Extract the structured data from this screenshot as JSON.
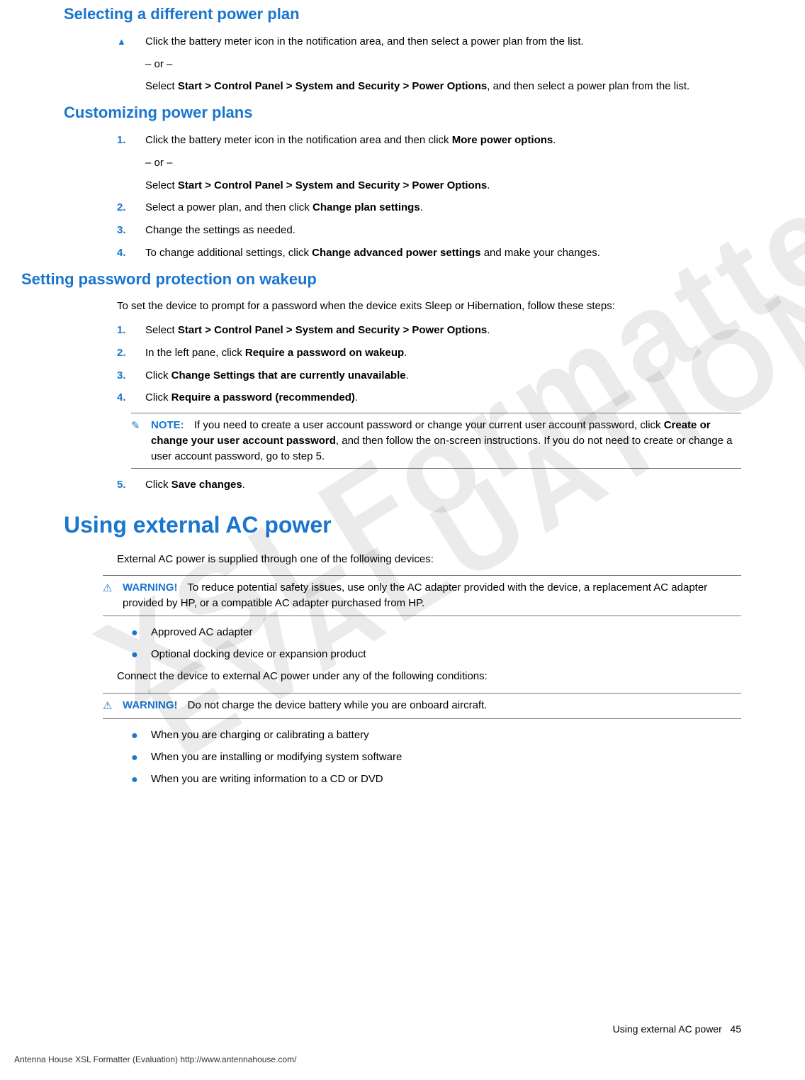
{
  "watermarks": {
    "w1": "XSLFormatter",
    "w2": "EVALUATION"
  },
  "s1": {
    "heading": "Selecting a different power plan",
    "step": "Click the battery meter icon in the notification area, and then select a power plan from the list.",
    "or": "– or –",
    "alt_pre": "Select ",
    "alt_bold": "Start > Control Panel > System and Security > Power Options",
    "alt_post": ", and then select a power plan from the list."
  },
  "s2": {
    "heading": "Customizing power plans",
    "step1_pre": "Click the battery meter icon in the notification area and then click ",
    "step1_bold": "More power options",
    "step1_post": ".",
    "or": "– or –",
    "step1b_pre": "Select ",
    "step1b_bold": "Start > Control Panel > System and Security > Power Options",
    "step1b_post": ".",
    "step2_pre": "Select a power plan, and then click ",
    "step2_bold": "Change plan settings",
    "step2_post": ".",
    "step3": "Change the settings as needed.",
    "step4_pre": "To change additional settings, click ",
    "step4_bold": "Change advanced power settings",
    "step4_post": " and make your changes."
  },
  "s3": {
    "heading": "Setting password protection on wakeup",
    "intro": "To set the device to prompt for a password when the device exits Sleep or Hibernation, follow these steps:",
    "step1_pre": "Select ",
    "step1_bold": "Start > Control Panel > System and Security > Power Options",
    "step1_post": ".",
    "step2_pre": "In the left pane, click ",
    "step2_bold": "Require a password on wakeup",
    "step2_post": ".",
    "step3_pre": "Click ",
    "step3_bold": "Change Settings that are currently unavailable",
    "step3_post": ".",
    "step4_pre": "Click ",
    "step4_bold": "Require a password (recommended)",
    "step4_post": ".",
    "note_label": "NOTE:",
    "note_pre": "If you need to create a user account password or change your current user account password, click ",
    "note_bold": "Create or change your user account password",
    "note_post": ", and then follow the on-screen instructions. If you do not need to create or change a user account password, go to step 5.",
    "step5_pre": "Click ",
    "step5_bold": "Save changes",
    "step5_post": "."
  },
  "s4": {
    "heading": "Using external AC power",
    "intro": "External AC power is supplied through one of the following devices:",
    "warn1_label": "WARNING!",
    "warn1_body": "To reduce potential safety issues, use only the AC adapter provided with the device, a replacement AC adapter provided by HP, or a compatible AC adapter purchased from HP.",
    "b1": "Approved AC adapter",
    "b2": "Optional docking device or expansion product",
    "connect": "Connect the device to external AC power under any of the following conditions:",
    "warn2_label": "WARNING!",
    "warn2_body": "Do not charge the device battery while you are onboard aircraft.",
    "c1": "When you are charging or calibrating a battery",
    "c2": "When you are installing or modifying system software",
    "c3": "When you are writing information to a CD or DVD"
  },
  "footer": {
    "right_text": "Using external AC power",
    "page_num": "45",
    "left": "Antenna House XSL Formatter (Evaluation)  http://www.antennahouse.com/"
  },
  "nums": {
    "n1": "1.",
    "n2": "2.",
    "n3": "3.",
    "n4": "4.",
    "n5": "5."
  }
}
